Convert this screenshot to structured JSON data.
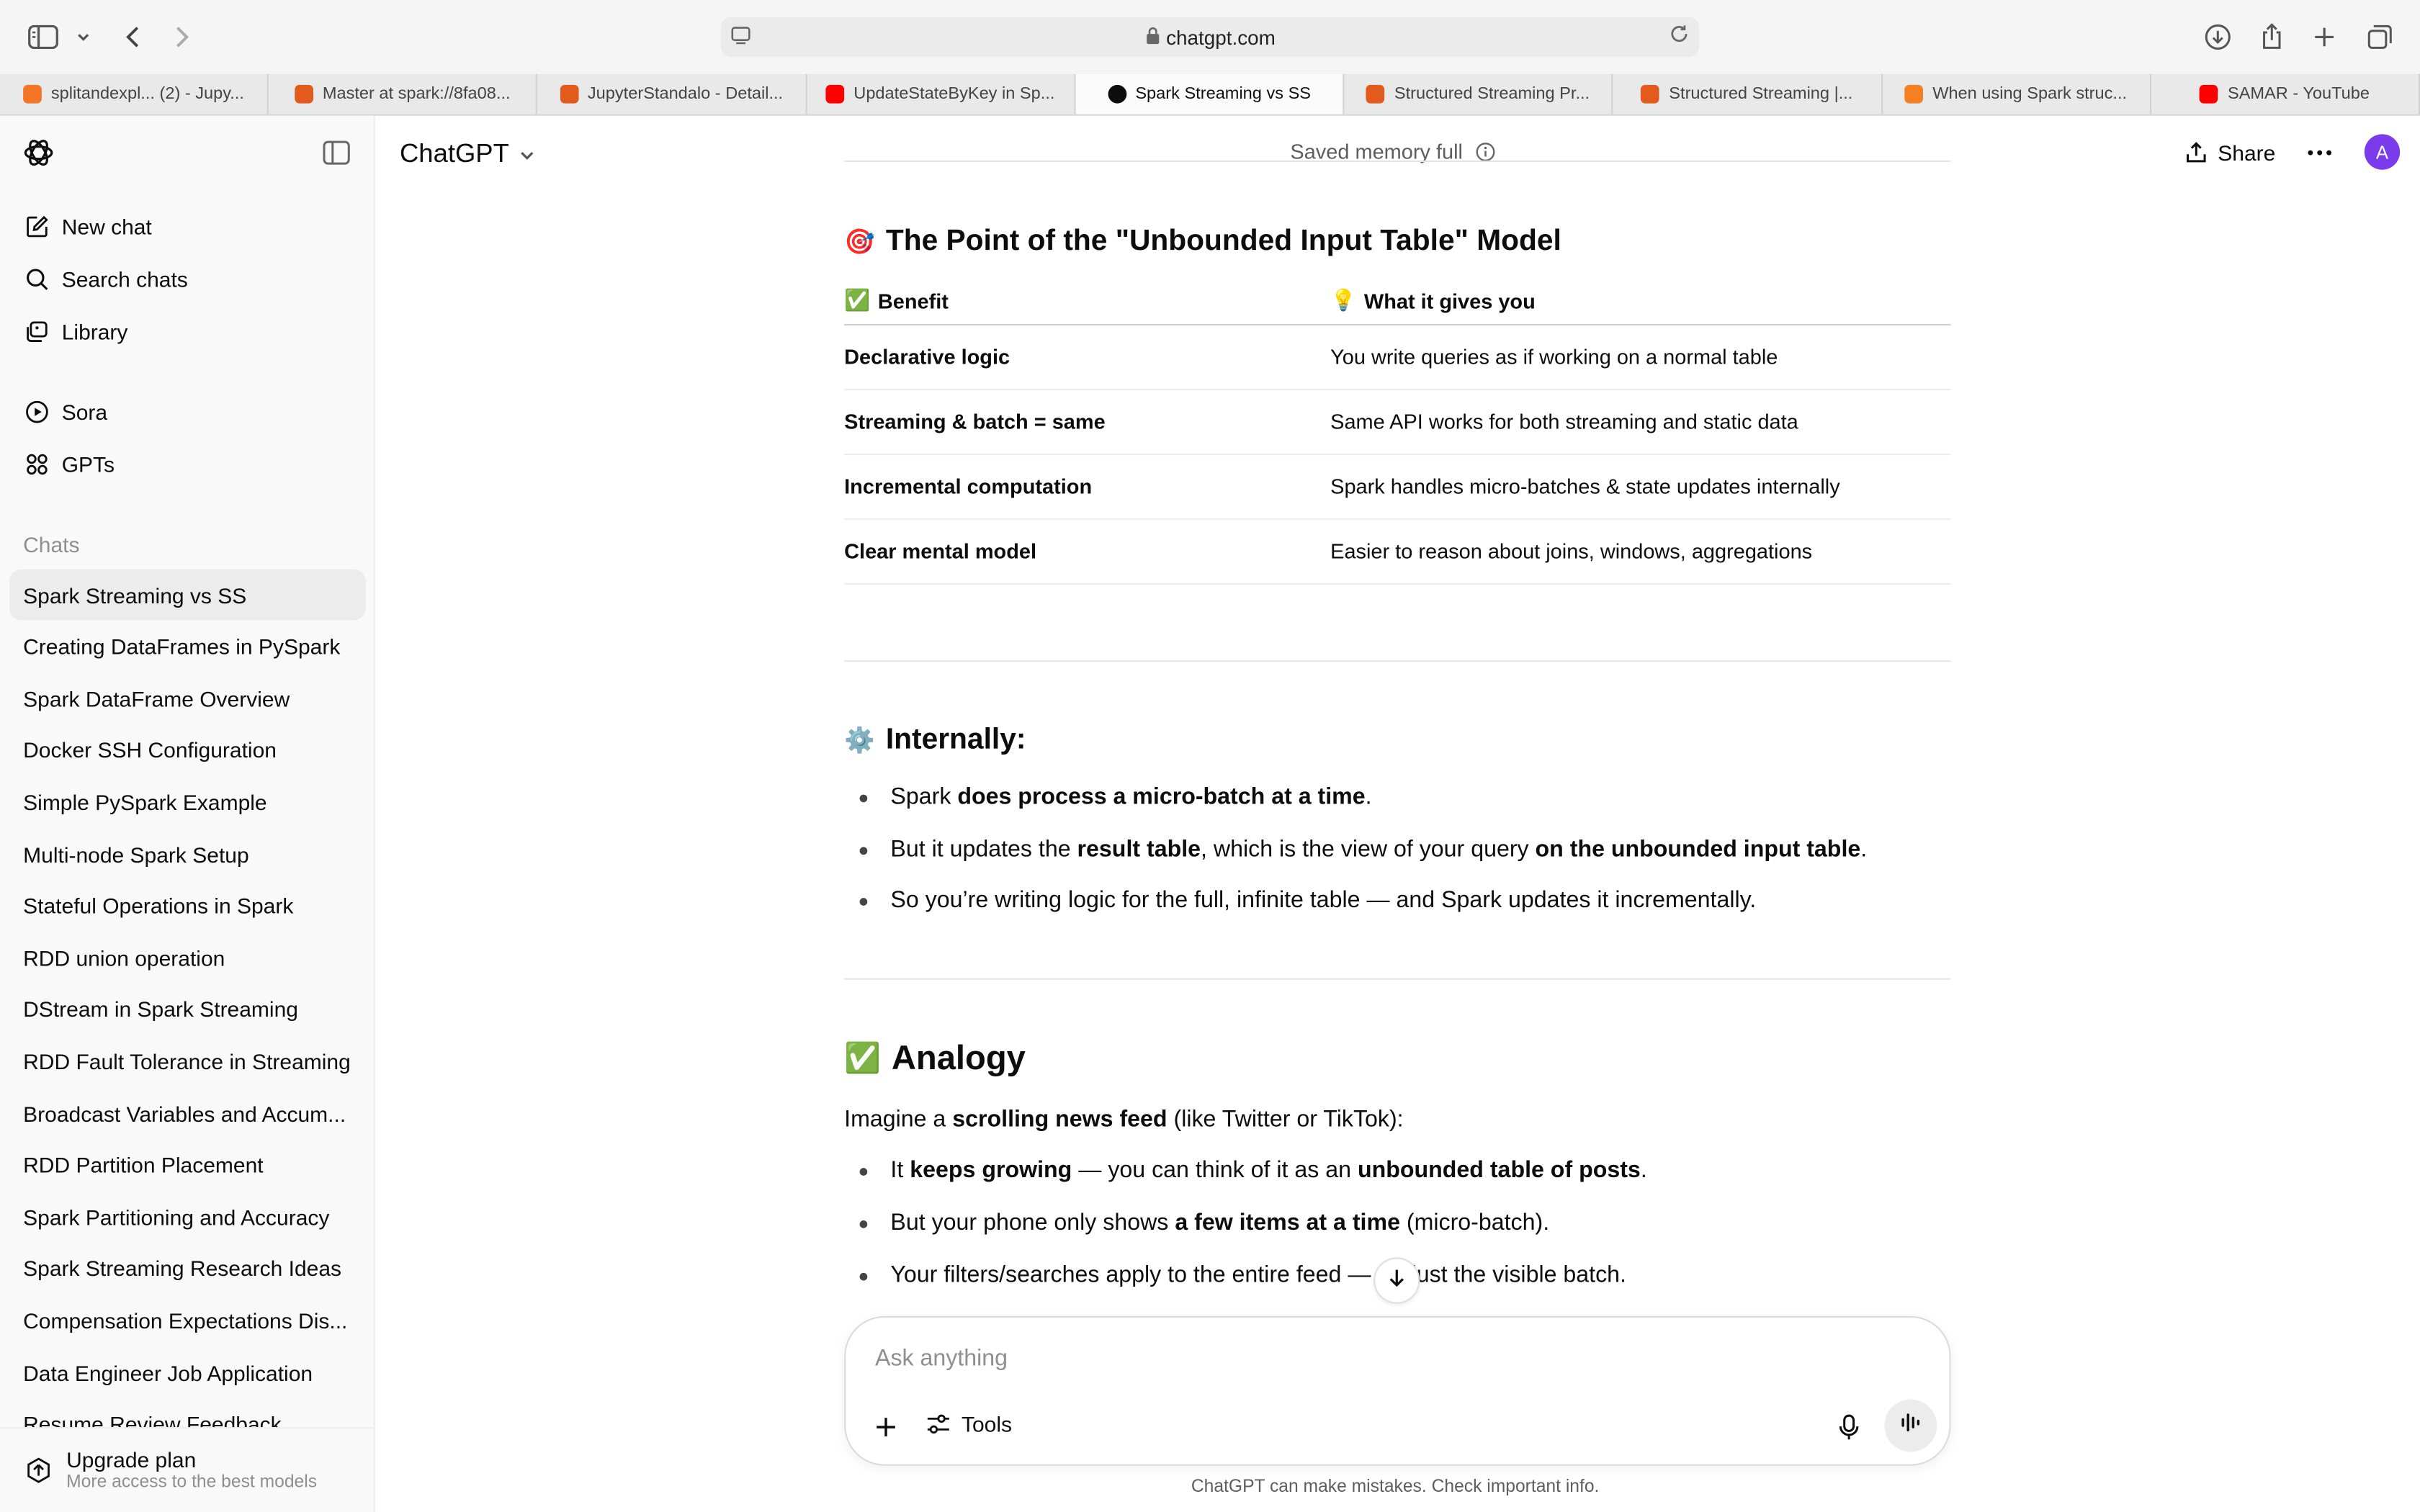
{
  "browser": {
    "url": "chatgpt.com",
    "tabs": [
      {
        "label": "splitandexpl... (2) - Jupy...",
        "fav_color": "#f37626"
      },
      {
        "label": "Master at spark://8fa08...",
        "fav_color": "#e25a1c"
      },
      {
        "label": "JupyterStandalo - Detail...",
        "fav_color": "#e25a1c"
      },
      {
        "label": "UpdateStateByKey in Sp...",
        "fav_color": "#ff0000"
      },
      {
        "label": "Spark Streaming vs SS",
        "fav_color": "#0d0d0d"
      },
      {
        "label": "Structured Streaming Pr...",
        "fav_color": "#e25a1c"
      },
      {
        "label": "Structured Streaming |...",
        "fav_color": "#e25a1c"
      },
      {
        "label": "When using Spark struc...",
        "fav_color": "#f48024"
      },
      {
        "label": "SAMAR - YouTube",
        "fav_color": "#ff0000"
      }
    ],
    "active_tab": 4
  },
  "sidebar": {
    "nav": [
      {
        "label": "New chat",
        "icon": "edit-icon"
      },
      {
        "label": "Search chats",
        "icon": "search-icon"
      },
      {
        "label": "Library",
        "icon": "library-icon"
      }
    ],
    "apps": [
      {
        "label": "Sora",
        "icon": "play-circle-icon"
      },
      {
        "label": "GPTs",
        "icon": "grid-icon"
      }
    ],
    "section_label": "Chats",
    "chats": [
      "Spark Streaming vs SS",
      "Creating DataFrames in PySpark",
      "Spark DataFrame Overview",
      "Docker SSH Configuration",
      "Simple PySpark Example",
      "Multi-node Spark Setup",
      "Stateful Operations in Spark",
      "RDD union operation",
      "DStream in Spark Streaming",
      "RDD Fault Tolerance in Streaming",
      "Broadcast Variables and Accum...",
      "RDD Partition Placement",
      "Spark Partitioning and Accuracy",
      "Spark Streaming Research Ideas",
      "Compensation Expectations Dis...",
      "Data Engineer Job Application",
      "Resume Review Feedback"
    ],
    "upgrade": {
      "title": "Upgrade plan",
      "subtitle": "More access to the best models"
    }
  },
  "header": {
    "model": "ChatGPT",
    "memory": "Saved memory full",
    "share": "Share",
    "avatar_initial": "A"
  },
  "content": {
    "section1": {
      "emoji": "🎯",
      "title": "The Point of the \"Unbounded Input Table\" Model",
      "table": {
        "headers": [
          {
            "emoji": "✅",
            "label": "Benefit"
          },
          {
            "emoji": "💡",
            "label": "What it gives you"
          }
        ],
        "rows": [
          [
            "Declarative logic",
            "You write queries as if working on a normal table"
          ],
          [
            "Streaming & batch = same",
            "Same API works for both streaming and static data"
          ],
          [
            "Incremental computation",
            "Spark handles micro-batches & state updates internally"
          ],
          [
            "Clear mental model",
            "Easier to reason about joins, windows, aggregations"
          ]
        ]
      }
    },
    "section2": {
      "emoji": "⚙️",
      "title": "Internally:",
      "b1": {
        "t1": "Spark ",
        "b1": "does process a micro-batch at a time",
        "t2": "."
      },
      "b2": {
        "t1": "But it updates the ",
        "b1": "result table",
        "t2": ", which is the view of your query ",
        "b2": "on the unbounded input table",
        "t3": "."
      },
      "b3": {
        "t1": "So you’re writing logic for the full, infinite table — and Spark updates it incrementally."
      }
    },
    "section3": {
      "emoji": "✅",
      "title": "Analogy",
      "intro": {
        "t1": "Imagine a ",
        "b1": "scrolling news feed",
        "t2": " (like Twitter or TikTok):"
      },
      "b1": {
        "t1": "It ",
        "b1": "keeps growing",
        "t2": " — you can think of it as an ",
        "b2": "unbounded table of posts",
        "t3": "."
      },
      "b2": {
        "t1": "But your phone only shows ",
        "b1": "a few items at a time",
        "t2": " (micro-batch)."
      },
      "b3": {
        "t1": "Your filters/searches apply to the entire feed — ",
        "t2": "just the visible batch."
      }
    }
  },
  "composer": {
    "placeholder": "Ask anything",
    "tools": "Tools"
  },
  "footer": "ChatGPT can make mistakes. Check important info."
}
